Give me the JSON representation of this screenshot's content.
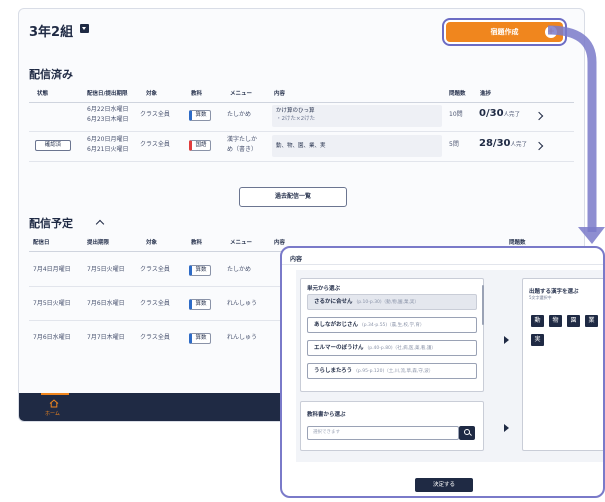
{
  "header": {
    "class_title": "3年2組",
    "create_button": "宿題作成"
  },
  "delivered": {
    "title": "配信済み",
    "columns": [
      "状態",
      "配信日/提出期限",
      "対象",
      "教科",
      "メニュー",
      "内容",
      "問題数",
      "進捗"
    ],
    "rows": [
      {
        "status": "",
        "date1": "6月22日水曜日",
        "date2": "6月23日木曜日",
        "target": "クラス全員",
        "subject": "算数",
        "menu": "たしかめ",
        "content1": "かけ算のひっ算",
        "content2": "・2けた×2けた",
        "count": "10問",
        "progress": "0/30",
        "progress_suffix": "人完了"
      },
      {
        "status": "確認済",
        "date1": "6月20日月曜日",
        "date2": "6月21日火曜日",
        "target": "クラス全員",
        "subject": "国語",
        "menu": "漢字たしか",
        "menu2": "め（書き）",
        "content1": "動、物、園、業、実",
        "content2": "",
        "count": "5問",
        "progress": "28/30",
        "progress_suffix": "人完了"
      }
    ],
    "past_button": "過去配信一覧"
  },
  "scheduled": {
    "title": "配信予定",
    "columns": [
      "配信日",
      "提出期限",
      "対象",
      "教科",
      "メニュー",
      "内容",
      "問題数"
    ],
    "rows": [
      {
        "date": "7月4日月曜日",
        "due": "7月5日火曜日",
        "target": "クラス全員",
        "subject": "算数",
        "menu": "たしかめ"
      },
      {
        "date": "7月5日火曜日",
        "due": "7月6日水曜日",
        "target": "クラス全員",
        "subject": "算数",
        "menu": "れんしゅう"
      },
      {
        "date": "7月6日水曜日",
        "due": "7月7日木曜日",
        "target": "クラス全員",
        "subject": "算数",
        "menu": "れんしゅう"
      }
    ]
  },
  "footer": {
    "home_label": "ホーム"
  },
  "dialog": {
    "title": "内容",
    "units_title": "単元から選ぶ",
    "units": [
      {
        "name": "さるかに合せん",
        "range": "(p.10-p.30)（動,物,園,業,実）"
      },
      {
        "name": "あしながおじさん",
        "range": "(p.34-p.55)（農,生,校,学,育）"
      },
      {
        "name": "エルマーのぼうけん",
        "range": "(p.40-p.80)（社,病,医,薬,看,護）"
      },
      {
        "name": "うらしまたろう",
        "range": "(p.95-p.120)（土,川,流,草,森,守,波）"
      }
    ],
    "search_title": "教科書から選ぶ",
    "search_placeholder": "選択できます",
    "kanji_title": "出題する漢字を選ぶ",
    "kanji_subtitle": "5文字選択中",
    "kanji": [
      "動",
      "物",
      "園",
      "業",
      "実"
    ],
    "decide_button": "決定する"
  }
}
